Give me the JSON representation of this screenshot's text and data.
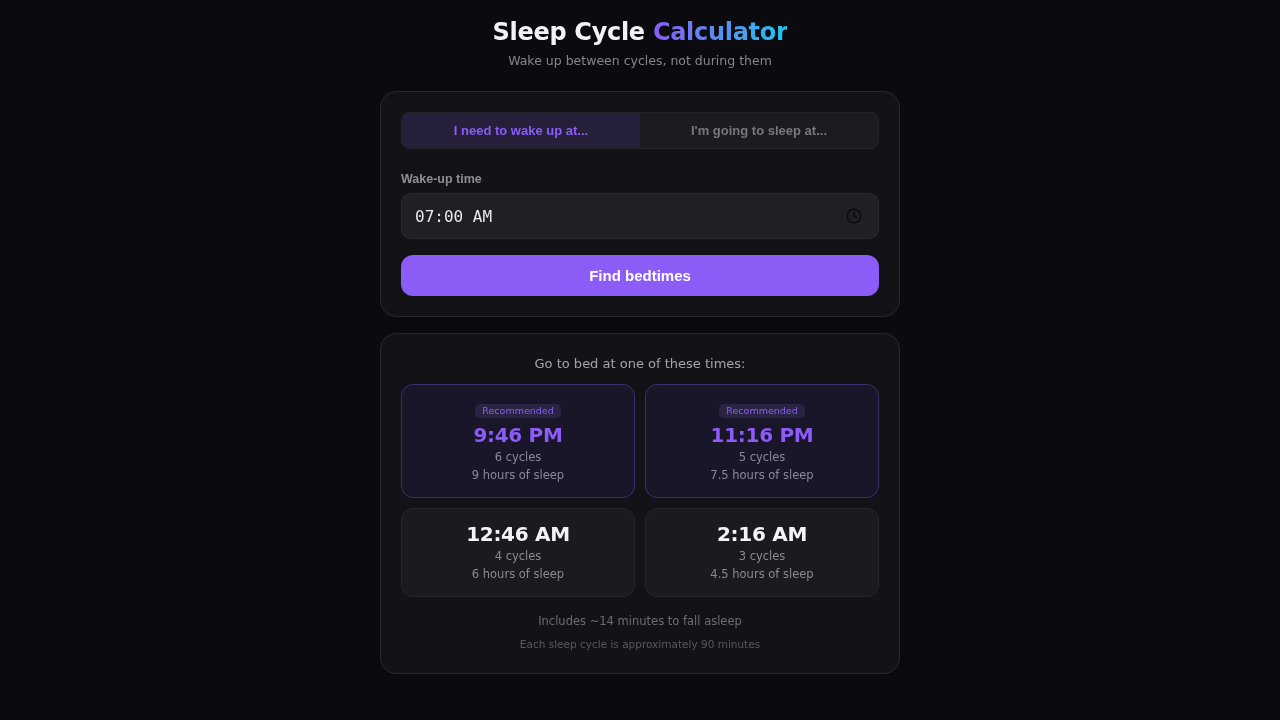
{
  "header": {
    "title": {
      "text": "Sleep Cycle",
      "accent": "Calculator"
    },
    "subtitle": "Wake up between cycles, not during them"
  },
  "mode_tabs": [
    {
      "label": "I need to wake up at...",
      "selected": true
    },
    {
      "label": "I'm going to sleep at...",
      "selected": false
    }
  ],
  "time_field": {
    "label": "Wake-up time",
    "value": "07:00 AM"
  },
  "submit_button": "Find bedtimes",
  "results": {
    "heading": "Go to bed at one of these times:",
    "options": [
      {
        "recommended": true,
        "badge": "Recommended",
        "time": "9:46 PM",
        "cycles": "6 cycles",
        "duration": "9 hours of sleep"
      },
      {
        "recommended": true,
        "badge": "Recommended",
        "time": "11:16 PM",
        "cycles": "5 cycles",
        "duration": "7.5 hours of sleep"
      },
      {
        "recommended": false,
        "time": "12:46 AM",
        "cycles": "4 cycles",
        "duration": "6 hours of sleep"
      },
      {
        "recommended": false,
        "time": "2:16 AM",
        "cycles": "3 cycles",
        "duration": "4.5 hours of sleep"
      }
    ],
    "notes": [
      "Includes ~14 minutes to fall asleep",
      "Each sleep cycle is approximately 90 minutes"
    ]
  }
}
